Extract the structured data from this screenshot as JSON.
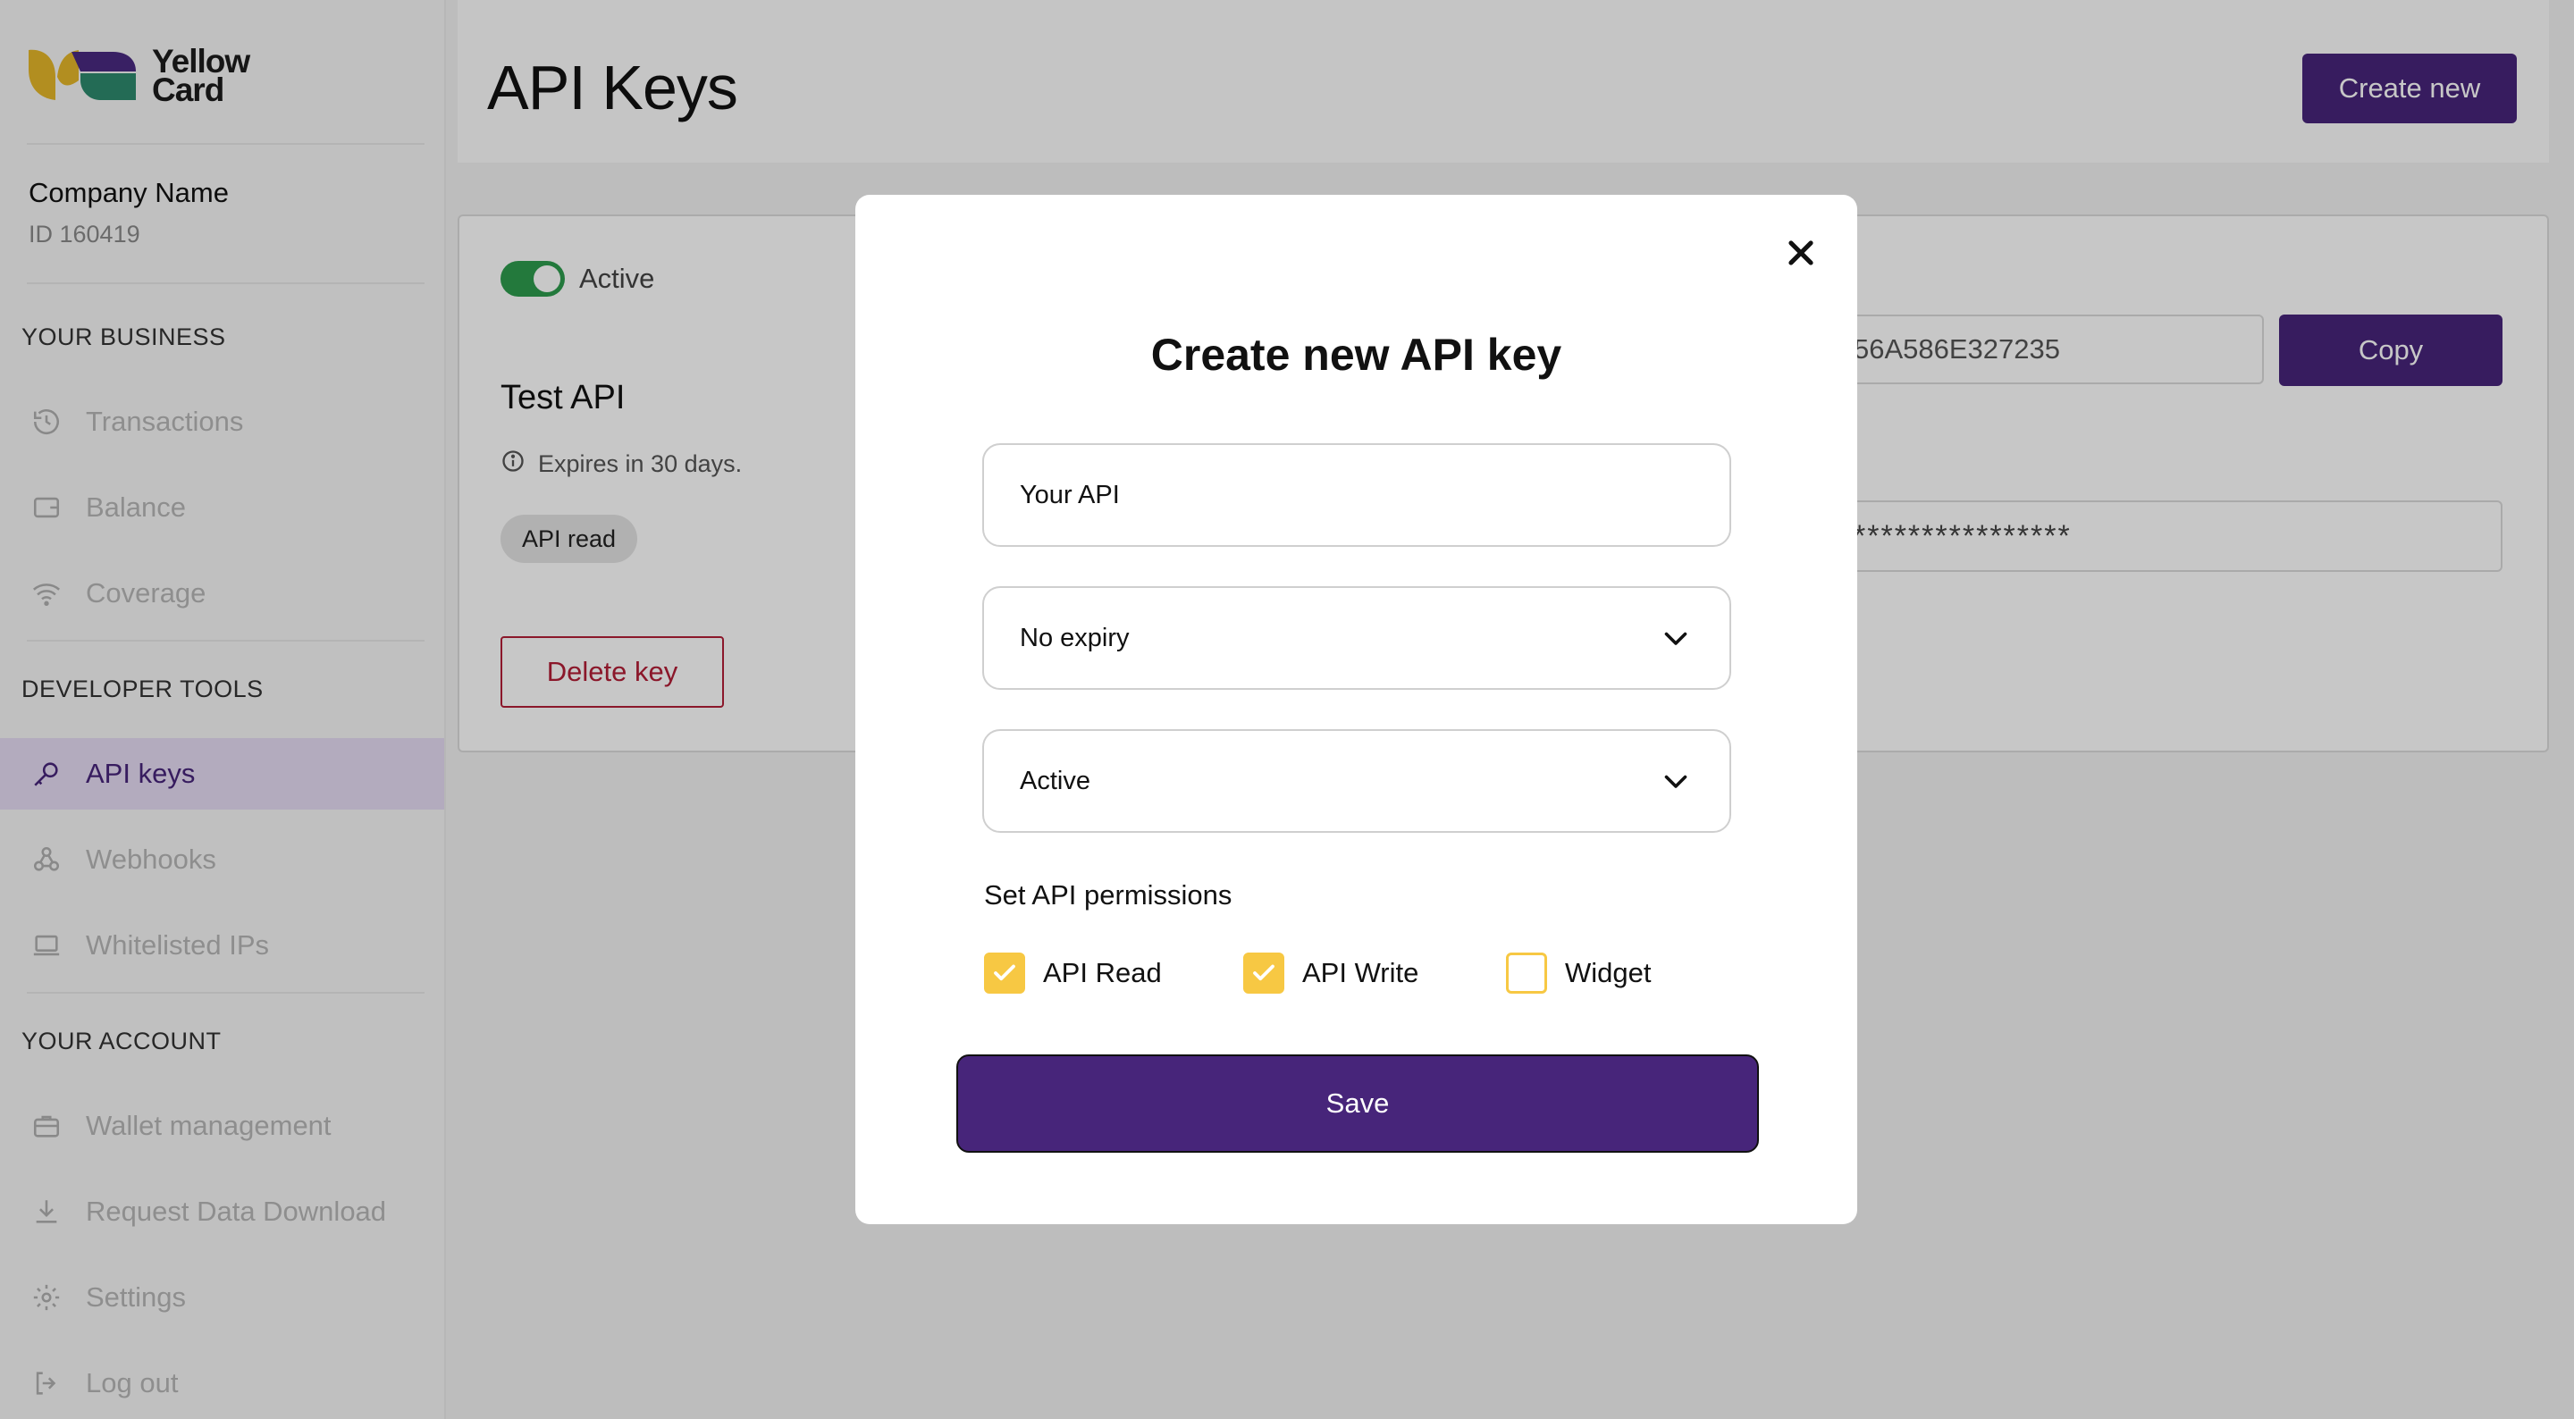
{
  "brand": {
    "logo_line1": "Yellow",
    "logo_line2": "Card"
  },
  "company": {
    "name": "Company Name",
    "id": "ID 160419"
  },
  "sidebar": {
    "sections": [
      {
        "title": "YOUR BUSINESS",
        "items": [
          {
            "label": "Transactions",
            "icon": "history-icon"
          },
          {
            "label": "Balance",
            "icon": "wallet-icon"
          },
          {
            "label": "Coverage",
            "icon": "wifi-icon"
          }
        ]
      },
      {
        "title": "DEVELOPER TOOLS",
        "items": [
          {
            "label": "API keys",
            "icon": "key-icon",
            "active": true
          },
          {
            "label": "Webhooks",
            "icon": "webhook-icon"
          },
          {
            "label": "Whitelisted IPs",
            "icon": "laptop-icon"
          }
        ]
      },
      {
        "title": "YOUR ACCOUNT",
        "items": [
          {
            "label": "Wallet management",
            "icon": "briefcase-icon"
          },
          {
            "label": "Request Data Download",
            "icon": "download-icon"
          },
          {
            "label": "Settings",
            "icon": "gear-icon"
          },
          {
            "label": "Log out",
            "icon": "logout-icon"
          }
        ]
      }
    ]
  },
  "header": {
    "title": "API Keys",
    "create_label": "Create new"
  },
  "api_card": {
    "status": "Active",
    "name": "Test API",
    "expires": "Expires in 30 days.",
    "permission_chip": "API read",
    "delete_label": "Delete key",
    "key_value": "56A586E327235",
    "copy_label": "Copy",
    "secret_value": "****************"
  },
  "modal": {
    "title": "Create new API key",
    "name_value": "Your API",
    "expiry_value": "No expiry",
    "status_value": "Active",
    "permissions_title": "Set API permissions",
    "permissions": [
      {
        "label": "API Read",
        "checked": true
      },
      {
        "label": "API Write",
        "checked": true
      },
      {
        "label": "Widget",
        "checked": false
      }
    ],
    "save_label": "Save"
  },
  "colors": {
    "brand_purple": "#47257a",
    "accent_yellow": "#f7c843",
    "danger": "#b21e36",
    "success": "#2e9b4e"
  }
}
